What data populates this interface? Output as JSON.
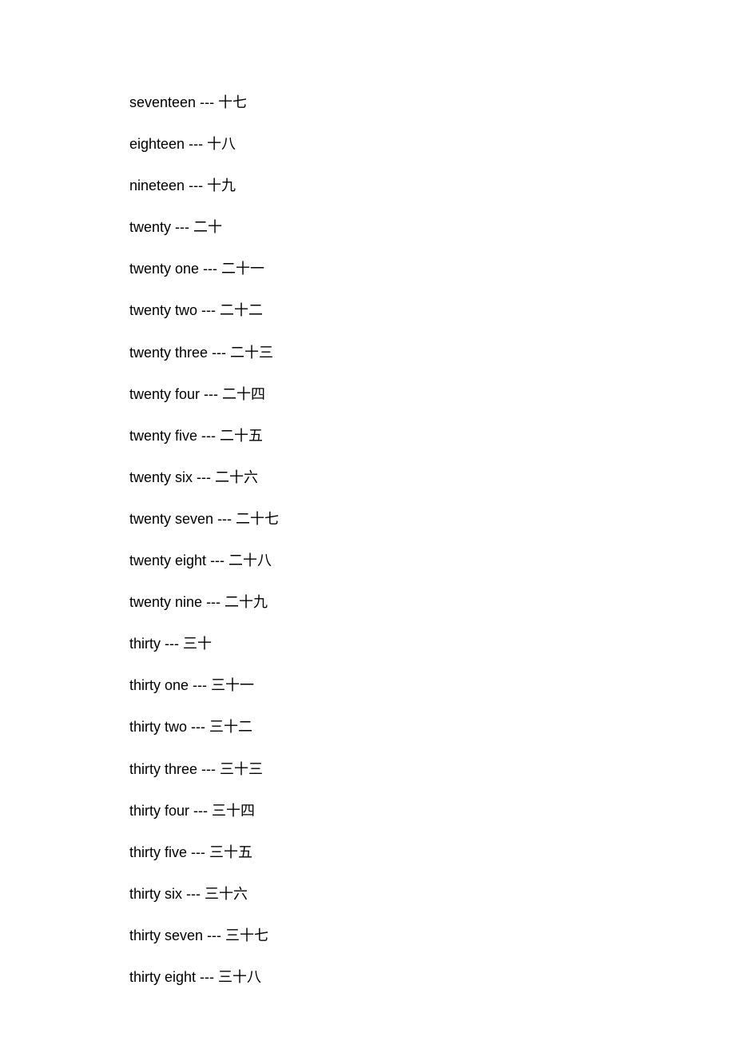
{
  "entries": [
    {
      "english": "seventeen",
      "chinese": "十七"
    },
    {
      "english": "eighteen",
      "chinese": "十八"
    },
    {
      "english": "nineteen",
      "chinese": "十九"
    },
    {
      "english": "twenty",
      "chinese": "二十"
    },
    {
      "english": "twenty one",
      "chinese": "二十一"
    },
    {
      "english": "twenty two",
      "chinese": "二十二"
    },
    {
      "english": "twenty three",
      "chinese": "二十三"
    },
    {
      "english": "twenty four",
      "chinese": "二十四"
    },
    {
      "english": "twenty five",
      "chinese": "二十五"
    },
    {
      "english": "twenty six",
      "chinese": "二十六"
    },
    {
      "english": "twenty seven",
      "chinese": "二十七"
    },
    {
      "english": "twenty eight",
      "chinese": "二十八"
    },
    {
      "english": "twenty nine",
      "chinese": "二十九"
    },
    {
      "english": "thirty",
      "chinese": "三十"
    },
    {
      "english": "thirty one",
      "chinese": "三十一"
    },
    {
      "english": "thirty two",
      "chinese": "三十二"
    },
    {
      "english": "thirty three",
      "chinese": "三十三"
    },
    {
      "english": "thirty four",
      "chinese": "三十四"
    },
    {
      "english": "thirty five",
      "chinese": "三十五"
    },
    {
      "english": "thirty six",
      "chinese": "三十六"
    },
    {
      "english": "thirty seven",
      "chinese": "三十七"
    },
    {
      "english": "thirty eight",
      "chinese": "三十八"
    }
  ],
  "separator": " --- "
}
